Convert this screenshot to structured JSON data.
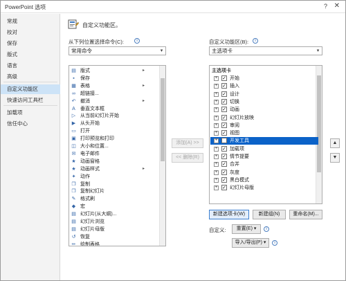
{
  "window": {
    "title": "PowerPoint 选项",
    "help_glyph": "?",
    "close_glyph": "✕"
  },
  "sidebar": {
    "items": [
      {
        "label": "常规"
      },
      {
        "label": "校对"
      },
      {
        "label": "保存"
      },
      {
        "label": "版式"
      },
      {
        "label": "语言"
      },
      {
        "label": "高级"
      },
      {
        "label": "自定义功能区"
      },
      {
        "label": "快速访问工具栏"
      },
      {
        "label": "加载项"
      },
      {
        "label": "信任中心"
      }
    ],
    "active_index": 6
  },
  "header": {
    "title": "自定义功能区。"
  },
  "left_panel": {
    "label": "从下列位置选择命令(C):",
    "info_glyph": "i",
    "combo_value": "常用命令",
    "commands": [
      {
        "icon": "slides-icon",
        "glyph": "▤",
        "label": "版式",
        "arrow": "▸"
      },
      {
        "icon": "save-icon",
        "glyph": "▪",
        "label": "保存",
        "arrow": ""
      },
      {
        "icon": "table-icon",
        "glyph": "▦",
        "label": "表格",
        "arrow": "▸"
      },
      {
        "icon": "link-icon",
        "glyph": "∞",
        "label": "超链接...",
        "arrow": ""
      },
      {
        "icon": "undo-icon",
        "glyph": "↶",
        "label": "撤消",
        "arrow": "▸"
      },
      {
        "icon": "vertical-text-icon",
        "glyph": "A",
        "label": "垂直文本框",
        "arrow": ""
      },
      {
        "icon": "play-current-icon",
        "glyph": "▷",
        "label": "从当前幻灯片开始",
        "arrow": ""
      },
      {
        "icon": "play-start-icon",
        "glyph": "▶",
        "label": "从头开始",
        "arrow": ""
      },
      {
        "icon": "open-icon",
        "glyph": "▭",
        "label": "打开",
        "arrow": ""
      },
      {
        "icon": "print-preview-icon",
        "glyph": "▣",
        "label": "打印预览和打印",
        "arrow": ""
      },
      {
        "icon": "size-position-icon",
        "glyph": "◫",
        "label": "大小和位置...",
        "arrow": ""
      },
      {
        "icon": "email-icon",
        "glyph": "✉",
        "label": "电子邮件",
        "arrow": ""
      },
      {
        "icon": "animation-pane-icon",
        "glyph": "★",
        "label": "动画窗格",
        "arrow": ""
      },
      {
        "icon": "animation-style-icon",
        "glyph": "★",
        "label": "动画样式",
        "arrow": "▸"
      },
      {
        "icon": "action-icon",
        "glyph": "✦",
        "label": "动作",
        "arrow": ""
      },
      {
        "icon": "copy-icon",
        "glyph": "❐",
        "label": "复制",
        "arrow": ""
      },
      {
        "icon": "duplicate-slide-icon",
        "glyph": "❐",
        "label": "复制幻灯片",
        "arrow": ""
      },
      {
        "icon": "format-painter-icon",
        "glyph": "✎",
        "label": "格式刷",
        "arrow": ""
      },
      {
        "icon": "shape-icon",
        "glyph": "◆",
        "label": "宏",
        "arrow": ""
      },
      {
        "icon": "outline-slides-icon",
        "glyph": "▤",
        "label": "幻灯片(从大纲)...",
        "arrow": ""
      },
      {
        "icon": "slide-browse-icon",
        "glyph": "▤",
        "label": "幻灯片浏览",
        "arrow": ""
      },
      {
        "icon": "slide-master-icon",
        "glyph": "▤",
        "label": "幻灯片母版",
        "arrow": ""
      },
      {
        "icon": "restore-icon",
        "glyph": "↺",
        "label": "恢复",
        "arrow": ""
      },
      {
        "icon": "draw-table-icon",
        "glyph": "✏",
        "label": "绘制表格",
        "arrow": ""
      }
    ]
  },
  "middle": {
    "add_label": "添加(A) >>",
    "remove_label": "<< 删除(R)"
  },
  "right_panel": {
    "label": "自定义功能区(B):",
    "info_glyph": "i",
    "combo_value": "主选项卡",
    "header_item": "主选项卡",
    "tabs": [
      {
        "label": "开始",
        "checked": true,
        "selected": false
      },
      {
        "label": "插入",
        "checked": true,
        "selected": false
      },
      {
        "label": "设计",
        "checked": true,
        "selected": false
      },
      {
        "label": "切换",
        "checked": true,
        "selected": false
      },
      {
        "label": "动画",
        "checked": true,
        "selected": false
      },
      {
        "label": "幻灯片放映",
        "checked": true,
        "selected": false
      },
      {
        "label": "审阅",
        "checked": true,
        "selected": false
      },
      {
        "label": "视图",
        "checked": true,
        "selected": false
      },
      {
        "label": "开发工具",
        "checked": false,
        "selected": true
      },
      {
        "label": "加载项",
        "checked": true,
        "selected": false
      },
      {
        "label": "情节提要",
        "checked": true,
        "selected": false
      },
      {
        "label": "合并",
        "checked": true,
        "selected": false
      },
      {
        "label": "灰度",
        "checked": true,
        "selected": false
      },
      {
        "label": "黑白模式",
        "checked": true,
        "selected": false
      },
      {
        "label": "幻灯片母版",
        "checked": true,
        "selected": false
      }
    ],
    "expand_glyph": "+",
    "check_glyph": "✓",
    "new_tab_label": "新建选项卡(W)",
    "new_group_label": "新建组(N)",
    "rename_label": "重命名(M)...",
    "customize_label": "自定义:",
    "reset_label": "重置(E) ▾",
    "import_export_label": "导入/导出(P) ▾",
    "move_up_glyph": "▲",
    "move_down_glyph": "▼"
  }
}
